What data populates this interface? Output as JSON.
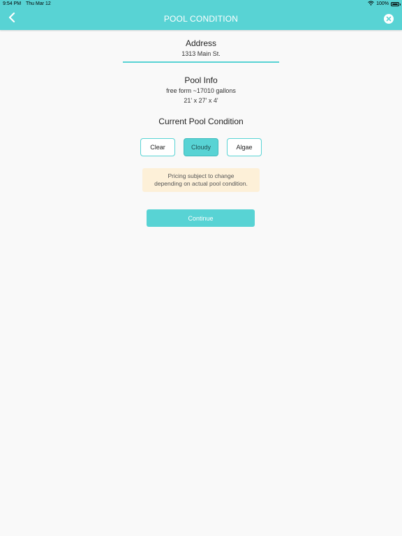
{
  "status_bar": {
    "time": "9:54 PM",
    "date": "Thu Mar 12",
    "battery_percent": "100%",
    "battery_level": 1.0
  },
  "nav": {
    "title": "POOL CONDITION",
    "back_icon": "chevron-left-icon",
    "close_icon": "close-circle-icon"
  },
  "address": {
    "label": "Address",
    "value": "1313 Main St."
  },
  "pool_info": {
    "label": "Pool Info",
    "line1": "free form ~17010 gallons",
    "line2": "21' x 27' x 4'"
  },
  "condition": {
    "label": "Current Pool Condition",
    "options": [
      "Clear",
      "Cloudy",
      "Algae"
    ],
    "selected": "Cloudy"
  },
  "notice": {
    "line1": "Pricing subject to change",
    "line2": "depending on actual pool condition."
  },
  "continue_label": "Continue",
  "colors": {
    "accent": "#58d3d4",
    "notice_bg": "#fdf0d8",
    "page_bg": "#f9f9f9"
  }
}
